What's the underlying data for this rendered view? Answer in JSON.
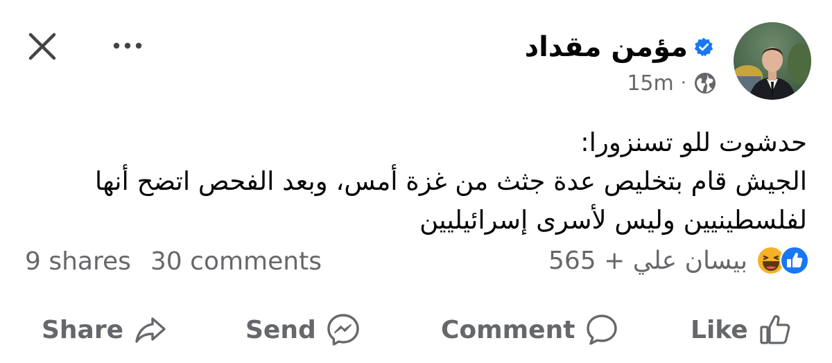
{
  "header": {
    "author_name": "مؤمن  مقداد",
    "timestamp": "15m",
    "separator": "·",
    "verified": true,
    "privacy_icon": "globe-icon",
    "close_icon": "close-icon",
    "more_icon": "more-options-icon"
  },
  "post": {
    "lines": [
      "حدشوت للو تسنزورا:",
      "الجيش قام بتخليص عدة جثث من غزة أمس، وبعد الفحص اتضح أنها",
      "لفلسطينيين وليس لأسرى إسرائيليين"
    ]
  },
  "engagement": {
    "shares": "9 shares",
    "comments": "30 comments",
    "reactions_text": "بيسان علي + 565",
    "reaction_icons": [
      "like-icon",
      "haha-icon"
    ]
  },
  "actions": {
    "share": "Share",
    "send": "Send",
    "comment": "Comment",
    "like": "Like"
  },
  "colors": {
    "accent": "#1877f2",
    "secondary_text": "#65676b",
    "primary_text": "#050505",
    "haha": "#f7b125"
  }
}
